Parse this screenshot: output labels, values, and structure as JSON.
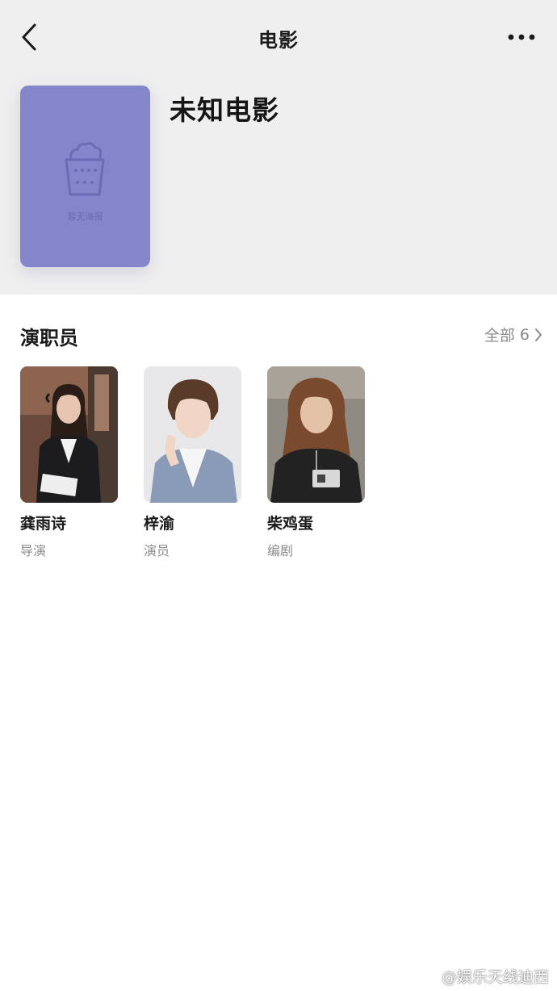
{
  "nav": {
    "title": "电影",
    "back_icon": "chevron-left-icon",
    "more_icon": "more-horizontal-icon"
  },
  "movie": {
    "title": "未知电影",
    "poster_placeholder_text": "暂无海报",
    "poster_icon": "popcorn-icon",
    "poster_color": "#8585cc"
  },
  "cast": {
    "section_title": "演职员",
    "see_all_label": "全部",
    "see_all_count": "6",
    "members": [
      {
        "name": "龚雨诗",
        "role": "导演"
      },
      {
        "name": "梓渝",
        "role": "演员"
      },
      {
        "name": "柴鸡蛋",
        "role": "编剧"
      }
    ]
  },
  "watermark": {
    "text": "@娱乐天线迪西"
  }
}
